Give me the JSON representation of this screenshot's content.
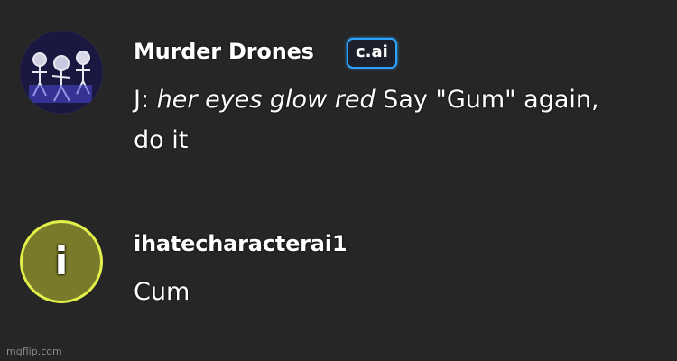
{
  "messages": [
    {
      "author": "Murder Drones",
      "badge": "c.ai",
      "speaker_prefix": "J: ",
      "action": "her eyes glow red",
      "line1_rest": " Say \"Gum\" again,",
      "line2": "do it",
      "avatar_icon": "murder-drones-avatar"
    },
    {
      "author": "ihatecharacterai1",
      "avatar_letter": "i",
      "avatar_color": "#7a7b2a",
      "avatar_border": "#e4f04a",
      "text": "Cum"
    }
  ],
  "watermark": "imgflip.com",
  "colors": {
    "background": "#262626",
    "badge_border": "#2aa3ff"
  }
}
